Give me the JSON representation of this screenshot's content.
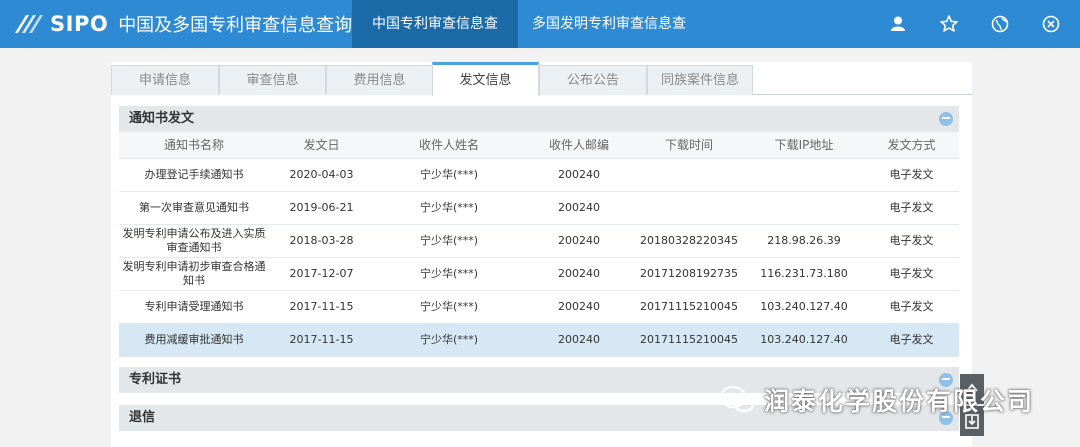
{
  "header": {
    "logo_text": "SIPO",
    "site_name": "中国及多国专利审查信息查询",
    "nav": [
      "中国专利审查信息查询",
      "多国发明专利审查信息查询"
    ],
    "tools": [
      "user-icon",
      "star-icon",
      "globe-icon",
      "close-icon"
    ]
  },
  "tabs": [
    "申请信息",
    "审查信息",
    "费用信息",
    "发文信息",
    "公布公告",
    "同族案件信息"
  ],
  "active_tab": "发文信息",
  "notice_section": {
    "title": "通知书发文",
    "columns": [
      "通知书名称",
      "发文日",
      "收件人姓名",
      "收件人邮编",
      "下载时间",
      "下载IP地址",
      "发文方式"
    ],
    "rows": [
      [
        "办理登记手续通知书",
        "2020-04-03",
        "宁少华(***)",
        "200240",
        "",
        "",
        "电子发文"
      ],
      [
        "第一次审查意见通知书",
        "2019-06-21",
        "宁少华(***)",
        "200240",
        "",
        "",
        "电子发文"
      ],
      [
        "发明专利申请公布及进入实质审查通知书",
        "2018-03-28",
        "宁少华(***)",
        "200240",
        "20180328220345",
        "218.98.26.39",
        "电子发文"
      ],
      [
        "发明专利申请初步审查合格通知书",
        "2017-12-07",
        "宁少华(***)",
        "200240",
        "20171208192735",
        "116.231.73.180",
        "电子发文"
      ],
      [
        "专利申请受理通知书",
        "2017-11-15",
        "宁少华(***)",
        "200240",
        "20171115210045",
        "103.240.127.40",
        "电子发文"
      ],
      [
        "费用减缓审批通知书",
        "2017-11-15",
        "宁少华(***)",
        "200240",
        "20171115210045",
        "103.240.127.40",
        "电子发文"
      ]
    ],
    "highlight_row": 5
  },
  "certificate_section": {
    "title": "专利证书"
  },
  "return_section": {
    "title": "退信"
  },
  "watermark": {
    "text": "润泰化学股份有限公司",
    "icon": "wechat-icon"
  }
}
